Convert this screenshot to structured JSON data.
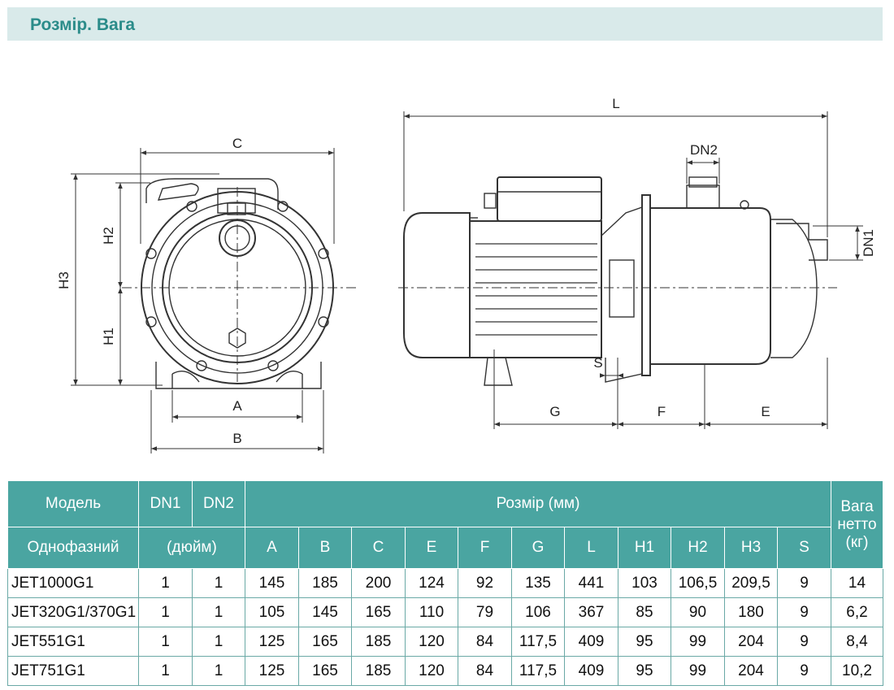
{
  "header": {
    "title": "Розмір. Вага"
  },
  "drawing": {
    "front_view_labels": {
      "c": "C",
      "h2": "H2",
      "h3": "H3",
      "h1": "H1",
      "a": "A",
      "b": "B"
    },
    "side_view_labels": {
      "l": "L",
      "dn2": "DN2",
      "dn1": "DN1",
      "s": "S",
      "g": "G",
      "f": "F",
      "e": "E"
    }
  },
  "table": {
    "head": {
      "model": "Модель",
      "single_phase": "Однофазний",
      "dn1": "DN1",
      "dn2": "DN2",
      "inch": "(дюйм)",
      "size": "Розмір (мм)",
      "weight_line1": "Вага",
      "weight_line2": "нетто",
      "weight_unit": "(кг)",
      "cols": [
        "A",
        "B",
        "C",
        "E",
        "F",
        "G",
        "L",
        "H1",
        "H2",
        "H3",
        "S"
      ]
    },
    "rows": [
      {
        "model": "JET1000G1",
        "dn1": "1",
        "dn2": "1",
        "a": "145",
        "b": "185",
        "c": "200",
        "e": "124",
        "f": "92",
        "g": "135",
        "l": "441",
        "h1": "103",
        "h2": "106,5",
        "h3": "209,5",
        "s": "9",
        "weight": "14"
      },
      {
        "model": "JET320G1/370G1",
        "dn1": "1",
        "dn2": "1",
        "a": "105",
        "b": "145",
        "c": "165",
        "e": "110",
        "f": "79",
        "g": "106",
        "l": "367",
        "h1": "85",
        "h2": "90",
        "h3": "180",
        "s": "9",
        "weight": "6,2"
      },
      {
        "model": "JET551G1",
        "dn1": "1",
        "dn2": "1",
        "a": "125",
        "b": "165",
        "c": "185",
        "e": "120",
        "f": "84",
        "g": "117,5",
        "l": "409",
        "h1": "95",
        "h2": "99",
        "h3": "204",
        "s": "9",
        "weight": "8,4"
      },
      {
        "model": "JET751G1",
        "dn1": "1",
        "dn2": "1",
        "a": "125",
        "b": "165",
        "c": "185",
        "e": "120",
        "f": "84",
        "g": "117,5",
        "l": "409",
        "h1": "95",
        "h2": "99",
        "h3": "204",
        "s": "9",
        "weight": "10,2"
      }
    ]
  }
}
